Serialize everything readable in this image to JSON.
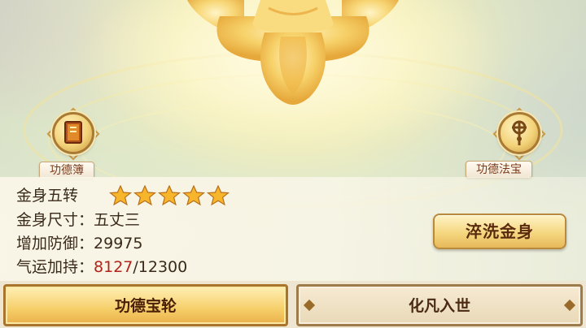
{
  "badges": {
    "left": {
      "label": "功德簿",
      "icon": "merit-book-icon"
    },
    "right": {
      "label": "功德法宝",
      "icon": "merit-treasure-icon"
    }
  },
  "stats": {
    "rank_label": "金身五转",
    "star_count": 5,
    "size_label": "金身尺寸：",
    "size_value": "五丈三",
    "defense_label": "增加防御：",
    "defense_value": "29975",
    "fortune_label": "气运加持：",
    "fortune_current": "8127",
    "fortune_max": "/12300"
  },
  "actions": {
    "wash_label": "淬洗金身"
  },
  "tabs": [
    {
      "label": "功德宝轮",
      "active": true
    },
    {
      "label": "化凡入世",
      "active": false
    }
  ],
  "colors": {
    "gold": "#f6cf6a",
    "accent_red": "#b3231a",
    "star": "#f7b52c"
  }
}
